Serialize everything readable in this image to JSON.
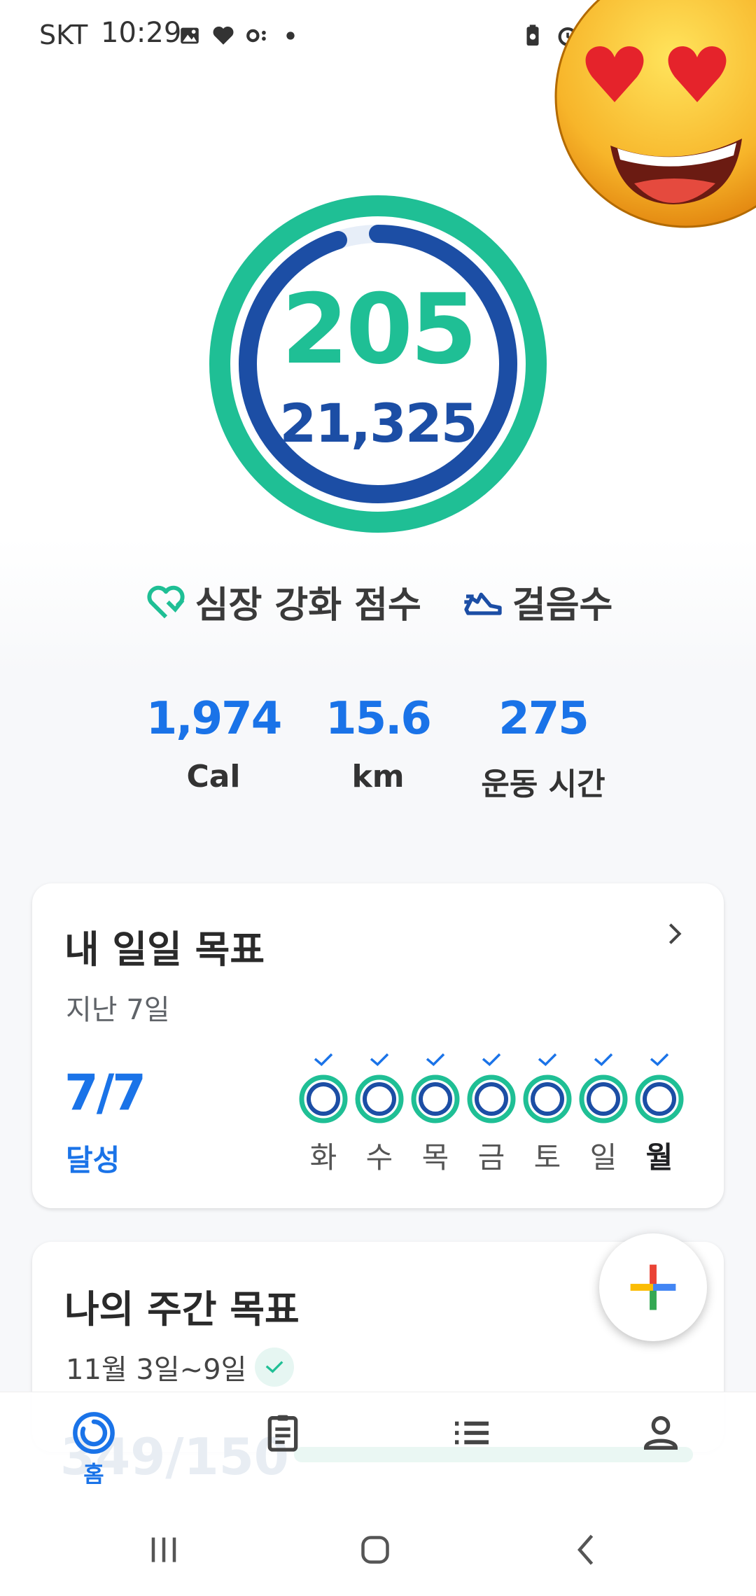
{
  "status_bar": {
    "carrier": "SKT",
    "time": "10:29",
    "icons": [
      "gallery-icon",
      "health-icon",
      "link-icon",
      "dot-icon",
      "battery-saver-icon",
      "alarm-icon"
    ]
  },
  "overlay": {
    "emoji": "heart-eyes-emoji"
  },
  "summary": {
    "primary_value": "205",
    "secondary_value": "21,325",
    "primary_color": "#1fbf95",
    "secondary_color": "#1c4ea5",
    "primary_progress": 1.0,
    "secondary_progress": 0.95
  },
  "legend": {
    "heart_points_label": "심장 강화 점수",
    "steps_label": "걸음수"
  },
  "stats": [
    {
      "value": "1,974",
      "label": "Cal"
    },
    {
      "value": "15.6",
      "label": "km"
    },
    {
      "value": "275",
      "label": "운동 시간"
    }
  ],
  "daily_goals": {
    "title": "내 일일 목표",
    "subtitle": "지난 7일",
    "achieved": "7/7",
    "achieved_label": "달성",
    "days": [
      "화",
      "수",
      "목",
      "금",
      "토",
      "일",
      "월"
    ],
    "today_index": 6
  },
  "weekly_goal": {
    "title": "나의 주간 목표",
    "date_range": "11월 3일~9일",
    "progress_text": "349/150"
  },
  "bottom_nav": {
    "home_label": "홈",
    "items": [
      "home-icon",
      "journal-icon",
      "browse-icon",
      "profile-icon"
    ]
  },
  "colors": {
    "accent_blue": "#1a73e8",
    "teal": "#1fbf95",
    "navy": "#1c4ea5"
  }
}
